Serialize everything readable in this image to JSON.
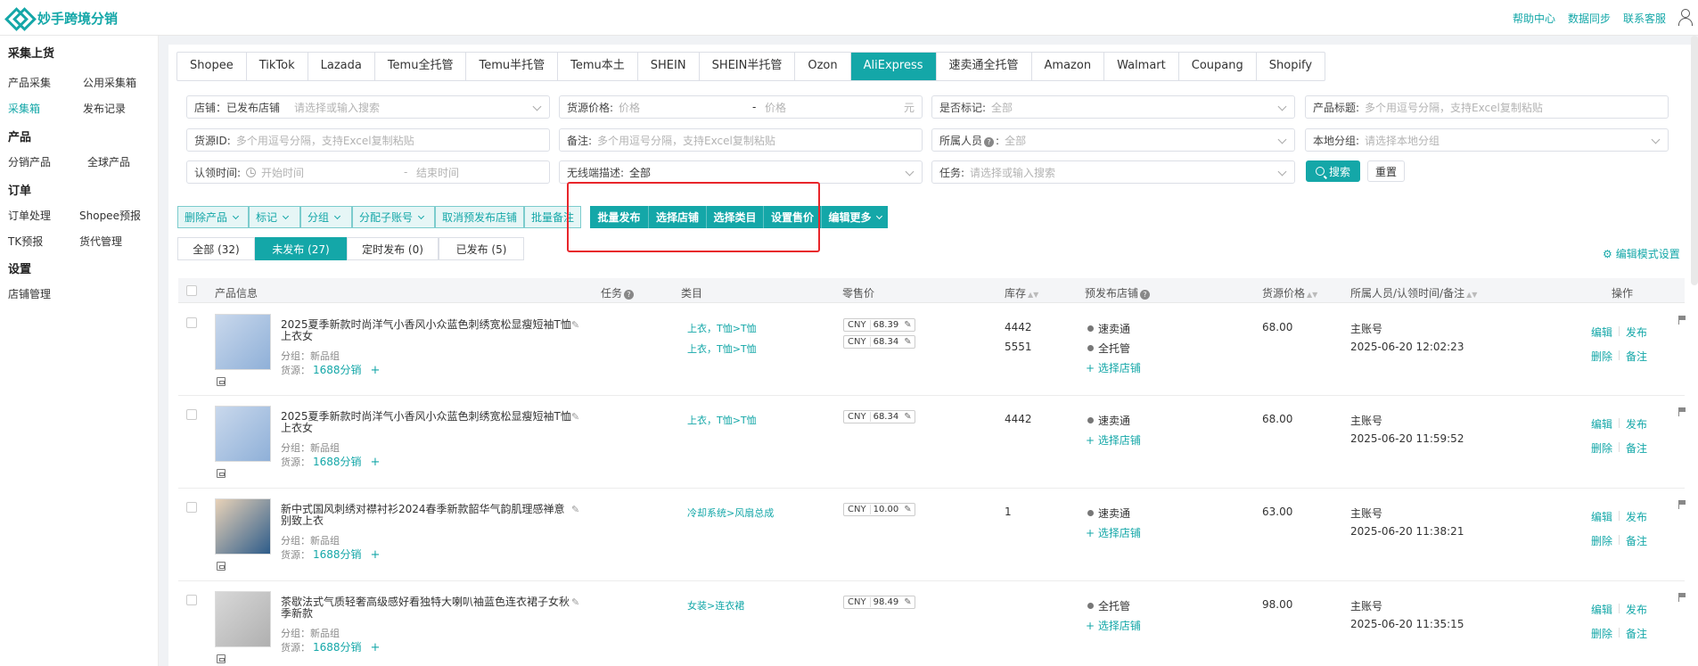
{
  "app": {
    "name": "妙手跨境分销"
  },
  "topbar": {
    "links": [
      "帮助中心",
      "数据同步",
      "联系客服"
    ]
  },
  "sidebar": {
    "sections": [
      {
        "heading": "采集上货",
        "items": [
          "产品采集",
          "公用采集箱",
          "采集箱",
          "发布记录"
        ]
      },
      {
        "heading": "产品",
        "items": [
          "分销产品",
          "全球产品"
        ]
      },
      {
        "heading": "订单",
        "items": [
          "订单处理",
          "Shopee预报",
          "TK预报",
          "货代管理"
        ]
      },
      {
        "heading": "设置",
        "items": [
          "店铺管理"
        ]
      }
    ],
    "active_item": "采集箱"
  },
  "platform_tabs": [
    "Shopee",
    "TikTok",
    "Lazada",
    "Temu全托管",
    "Temu半托管",
    "Temu本土",
    "SHEIN",
    "SHEIN半托管",
    "Ozon",
    "AliExpress",
    "速卖通全托管",
    "Amazon",
    "Walmart",
    "Coupang",
    "Shopify"
  ],
  "active_platform": "AliExpress",
  "filters": {
    "store_label": "店铺：已发布店铺",
    "store_placeholder": "请选择或输入搜索",
    "price_label": "货源价格:",
    "price_min_ph": "价格",
    "price_dash": "-",
    "price_max_ph": "价格",
    "price_unit": "元",
    "mark_label": "是否标记:",
    "mark_value": "全部",
    "title_label": "产品标题:",
    "title_ph": "多个用逗号分隔，支持Excel复制粘贴",
    "sourceid_label": "货源ID:",
    "sourceid_ph": "多个用逗号分隔，支持Excel复制粘贴",
    "note_label": "备注:",
    "note_ph": "多个用逗号分隔，支持Excel复制粘贴",
    "owner_label": "所属人员",
    "owner_value": "全部",
    "group_label": "本地分组:",
    "group_ph": "请选择本地分组",
    "claim_label": "认领时间:",
    "claim_start_ph": "开始时间",
    "claim_dash": "-",
    "claim_end_ph": "结束时间",
    "wireless_label": "无线端描述:",
    "wireless_value": "全部",
    "task_label": "任务:",
    "task_ph": "请选择或输入搜索",
    "search_btn": "搜索",
    "reset_btn": "重置"
  },
  "batch_actions_a": [
    "删除产品",
    "标记",
    "分组",
    "分配子账号",
    "取消预发布店铺",
    "批量备注"
  ],
  "batch_actions_b": [
    "批量发布",
    "选择店铺",
    "选择类目",
    "设置售价",
    "编辑更多"
  ],
  "status_tabs": [
    "全部 (32)",
    "未发布 (27)",
    "定时发布 (0)",
    "已发布 (5)"
  ],
  "active_status": "未发布 (27)",
  "edit_mode": "编辑模式设置",
  "table": {
    "headers": [
      "产品信息",
      "任务",
      "类目",
      "零售价",
      "库存",
      "预发布店铺",
      "货源价格",
      "所属人员/认领时间/备注",
      "操作"
    ],
    "group_prefix": "分组：",
    "source_prefix": "货源：",
    "select_store": "+ 选择店铺",
    "ops": {
      "edit": "编辑",
      "publish": "发布",
      "delete": "删除",
      "note": "备注"
    },
    "rows": [
      {
        "title": "2025夏季新款时尚洋气小香风小众蓝色刺绣宽松显瘦短袖T恤上衣女",
        "group": "新品组",
        "source": "1688分销",
        "categories": [
          "上衣，T恤>T恤",
          "上衣，T恤>T恤"
        ],
        "prices": [
          {
            "currency": "CNY",
            "amount": "68.39"
          },
          {
            "currency": "CNY",
            "amount": "68.34"
          }
        ],
        "stocks": [
          "4442",
          "5551"
        ],
        "stores": [
          "速卖通",
          "全托管"
        ],
        "source_price": "68.00",
        "owner": "主账号",
        "claim_time": "2025-06-20 12:02:23"
      },
      {
        "title": "2025夏季新款时尚洋气小香风小众蓝色刺绣宽松显瘦短袖T恤上衣女",
        "group": "新品组",
        "source": "1688分销",
        "categories": [
          "上衣，T恤>T恤"
        ],
        "prices": [
          {
            "currency": "CNY",
            "amount": "68.34"
          }
        ],
        "stocks": [
          "4442"
        ],
        "stores": [
          "速卖通"
        ],
        "source_price": "68.00",
        "owner": "主账号",
        "claim_time": "2025-06-20 11:59:52"
      },
      {
        "title": "新中式国风刺绣对襟衬衫2024春季新款韶华气韵肌理感禅意别致上衣",
        "group": "新品组",
        "source": "1688分销",
        "categories": [
          "冷却系统>风扇总成"
        ],
        "prices": [
          {
            "currency": "CNY",
            "amount": "10.00"
          }
        ],
        "stocks": [
          "1"
        ],
        "stores": [
          "速卖通"
        ],
        "source_price": "63.00",
        "owner": "主账号",
        "claim_time": "2025-06-20 11:38:21"
      },
      {
        "title": "茶歇法式气质轻奢高级感好看独特大喇叭袖蓝色连衣裙子女秋季新款",
        "group": "新品组",
        "source": "1688分销",
        "categories": [
          "女装>连衣裙"
        ],
        "prices": [
          {
            "currency": "CNY",
            "amount": "98.49"
          }
        ],
        "stocks": [],
        "stores": [
          "全托管"
        ],
        "source_price": "98.00",
        "owner": "主账号",
        "claim_time": "2025-06-20 11:35:15"
      }
    ]
  },
  "colors": {
    "accent": "#14a7a8",
    "highlight_box": "#e8262b"
  }
}
